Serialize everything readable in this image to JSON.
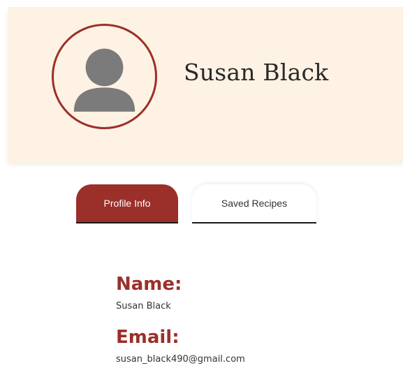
{
  "profile": {
    "name": "Susan Black",
    "avatar_icon": "user-silhouette-icon"
  },
  "tabs": [
    {
      "label": "Profile Info",
      "active": true
    },
    {
      "label": "Saved Recipes",
      "active": false
    }
  ],
  "info": {
    "name_heading": "Name:",
    "name_value": "Susan Black",
    "email_heading": "Email:",
    "email_value": "susan_black490@gmail.com"
  },
  "colors": {
    "accent": "#9b2f2a",
    "banner_bg": "#fdf2e3",
    "avatar_fill": "#7b7b7b"
  }
}
